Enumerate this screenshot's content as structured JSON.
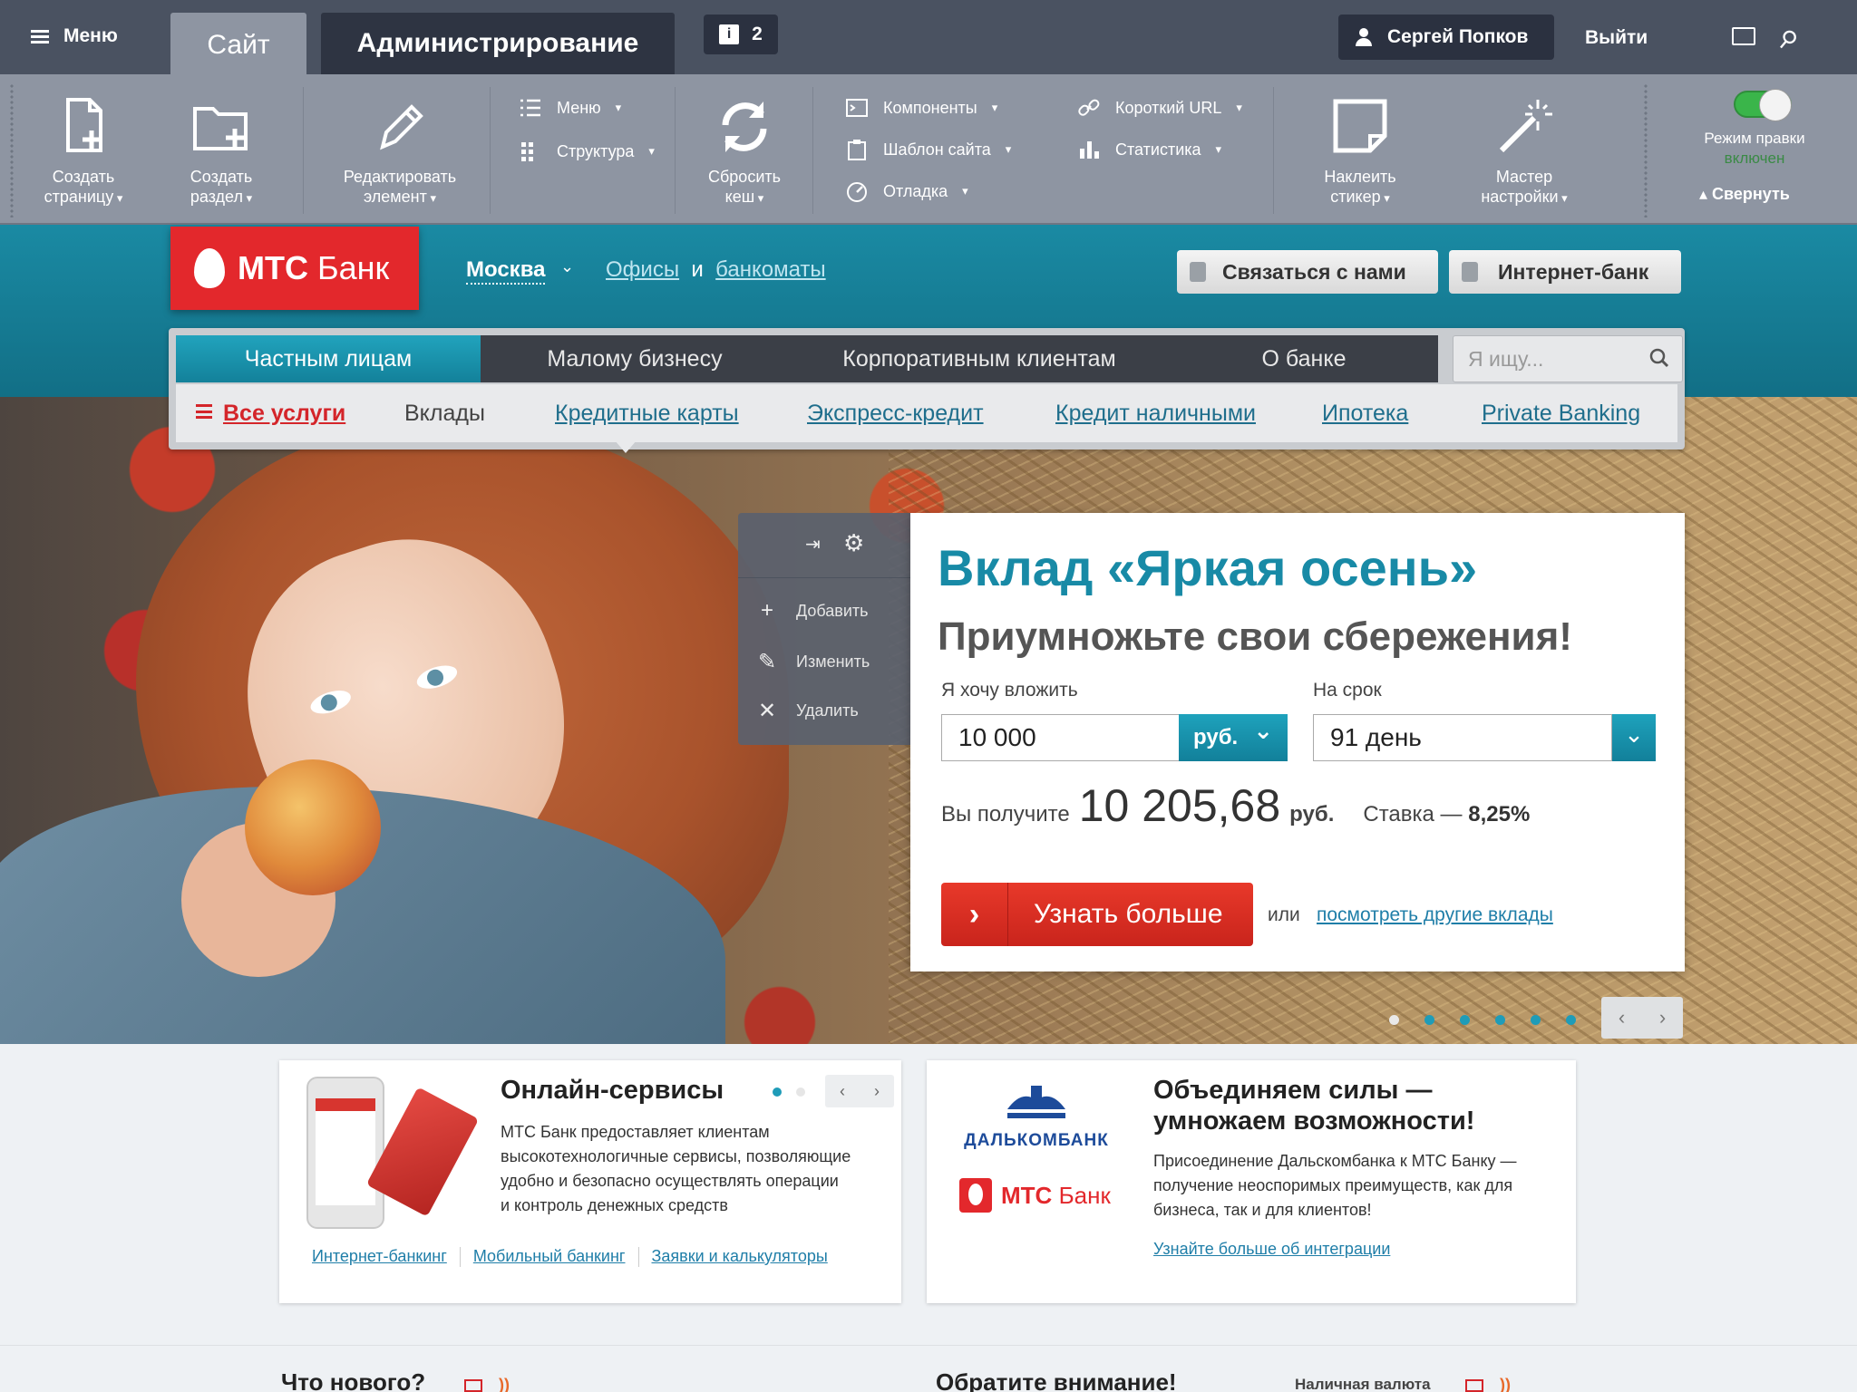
{
  "admin": {
    "menu_label": "Меню",
    "tab_site": "Сайт",
    "tab_admin": "Администрирование",
    "notifications": "2",
    "user_name": "Сергей Попков",
    "logout": "Выйти"
  },
  "toolbar": {
    "create_page": [
      "Создать",
      "страницу"
    ],
    "create_section": [
      "Создать",
      "раздел"
    ],
    "edit_element": [
      "Редактировать",
      "элемент"
    ],
    "menu": "Меню",
    "structure": "Структура",
    "reset_cache": [
      "Сбросить",
      "кеш"
    ],
    "components": "Компоненты",
    "site_template": "Шаблон сайта",
    "debug": "Отладка",
    "short_url": "Короткий URL",
    "statistics": "Статистика",
    "sticker": [
      "Наклеить",
      "стикер"
    ],
    "wizard": [
      "Мастер",
      "настройки"
    ],
    "edit_mode": "Режим правки",
    "edit_mode_state": "включен",
    "collapse": "Свернуть"
  },
  "header": {
    "logo_bold": "МТС",
    "logo_rest": "Банк",
    "city": "Москва",
    "offices": "Офисы",
    "and": "и",
    "atms": "банкоматы",
    "contact_btn": "Связаться с нами",
    "ibank_btn": "Интернет-банк"
  },
  "nav": {
    "main_tabs": [
      "Частным лицам",
      "Малому бизнесу",
      "Корпоративным клиентам",
      "О банке"
    ],
    "search_placeholder": "Я ищу...",
    "sub": {
      "all": "Все услуги",
      "deposits": "Вклады",
      "credit_cards": "Кредитные карты",
      "express": "Экспресс-кредит",
      "cash_credit": "Кредит наличными",
      "mortgage": "Ипотека",
      "private": "Private Banking"
    }
  },
  "edit_panel": {
    "add": "Добавить",
    "change": "Изменить",
    "delete": "Удалить"
  },
  "deposit": {
    "title": "Вклад «Яркая осень»",
    "subtitle": "Приумножьте свои сбережения!",
    "amount_label": "Я хочу вложить",
    "amount_value": "10 000",
    "currency": "руб.",
    "term_label": "На срок",
    "term_value": "91 день",
    "result_prefix": "Вы получите",
    "result_value": "10 205,68",
    "result_unit": "руб.",
    "rate_label": "Ставка —",
    "rate_value": "8,25%",
    "cta": "Узнать больше",
    "or": "или",
    "other_link": "посмотреть другие вклады"
  },
  "online": {
    "title": "Онлайн-сервисы",
    "text": [
      "МТС Банк предоставляет клиентам",
      "высокотехнологичные сервисы, позволяющие",
      "удобно и безопасно осуществлять операции",
      "и контроль денежных средств"
    ],
    "links": [
      "Интернет-банкинг",
      "Мобильный банкинг",
      "Заявки и калькуляторы"
    ]
  },
  "merger": {
    "partner": "ДАЛЬКОМБАНК",
    "mts_bold": "МТС",
    "mts_rest": "Банк",
    "title": [
      "Объединяем силы —",
      "умножаем возможности!"
    ],
    "text": [
      "Присоединение Дальскомбанка к МТС Банку —",
      "получение неоспоримых преимуществ, как для",
      "бизнеса, так и для клиентов!"
    ],
    "link": "Узнайте больше об интеграции"
  },
  "bottom": {
    "news": "Что нового?",
    "attention": "Обратите внимание!",
    "currency": "Наличная валюта"
  },
  "colors": {
    "teal": "#1a8aa3",
    "red": "#e3282c",
    "admin_dark": "#4a5261",
    "admin_light": "#8e95a2"
  }
}
